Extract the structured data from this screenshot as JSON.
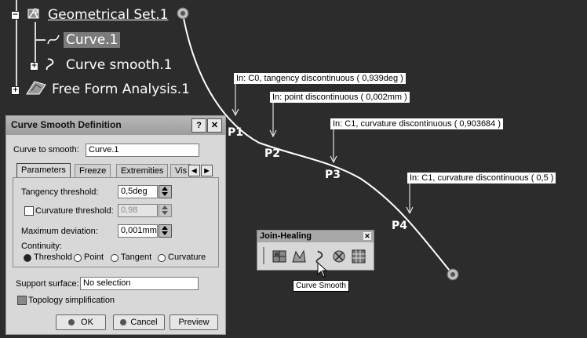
{
  "tree": {
    "root_label": "Geometrical Set.1",
    "children": [
      {
        "label": "Curve.1"
      },
      {
        "label": "Curve smooth.1"
      }
    ],
    "sibling_label": "Free Form Analysis.1"
  },
  "annotations": [
    {
      "text": "In: C0, tangency discontinuous ( 0,939deg )"
    },
    {
      "text": "In: point discontinuous ( 0,002mm )"
    },
    {
      "text": "In: C1, curvature discontinuous ( 0,903684 )"
    },
    {
      "text": "In: C1, curvature discontinuous ( 0,5 )"
    }
  ],
  "points": [
    "P1",
    "P2",
    "P3",
    "P4"
  ],
  "dialog": {
    "title": "Curve Smooth Definition",
    "help_label": "?",
    "close_label": "✕",
    "curve_label": "Curve to smooth:",
    "curve_value": "Curve.1",
    "tabs": [
      "Parameters",
      "Freeze",
      "Extremities",
      "Vis"
    ],
    "tangency_label": "Tangency threshold:",
    "tangency_value": "0,5deg",
    "curvature_label": "Curvature threshold:",
    "curvature_value": "0,98",
    "curvature_checked": false,
    "max_dev_label": "Maximum deviation:",
    "max_dev_value": "0,001mm",
    "continuity_label": "Continuity:",
    "continuity_options": [
      "Threshold",
      "Point",
      "Tangent",
      "Curvature"
    ],
    "continuity_selected": "Threshold",
    "support_label": "Support surface:",
    "support_value": "No selection",
    "topology_label": "Topology simplification",
    "ok_label": "OK",
    "cancel_label": "Cancel",
    "preview_label": "Preview"
  },
  "toolbar": {
    "title": "Join-Healing",
    "close_label": "✕",
    "icons": [
      "join-icon",
      "healing-icon",
      "curve-smooth-icon",
      "untrim-icon",
      "disassemble-icon"
    ],
    "tooltip": "Curve Smooth"
  },
  "colors": {
    "background": "#2c2c2c",
    "curve": "#ffffff",
    "dialog": "#d8d8d8"
  }
}
